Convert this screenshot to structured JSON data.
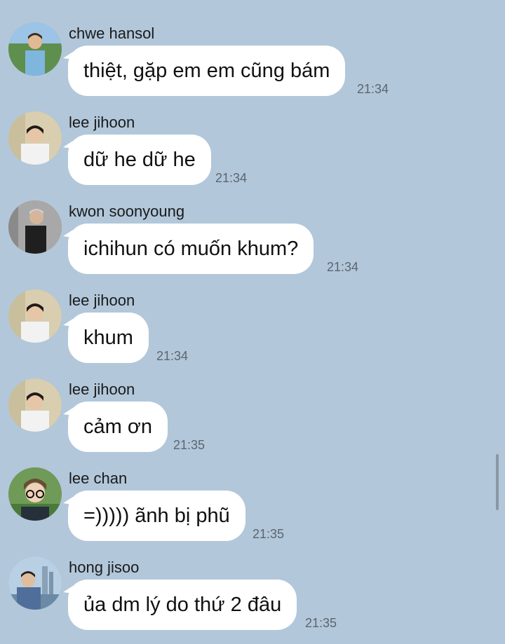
{
  "messages": [
    {
      "sender": "chwe hansol",
      "text": "thiệt, gặp em em cũng bám",
      "time": "21:34",
      "avatar": "chwe-hansol-avatar"
    },
    {
      "sender": "lee jihoon",
      "text": "dữ he dữ he",
      "time": "21:34",
      "avatar": "lee-jihoon-avatar"
    },
    {
      "sender": "kwon soonyoung",
      "text": "ichihun có muốn khum?",
      "time": "21:34",
      "avatar": "kwon-soonyoung-avatar"
    },
    {
      "sender": "lee jihoon",
      "text": "khum",
      "time": "21:34",
      "avatar": "lee-jihoon-avatar"
    },
    {
      "sender": "lee jihoon",
      "text": "cảm ơn",
      "time": "21:35",
      "avatar": "lee-jihoon-avatar"
    },
    {
      "sender": "lee chan",
      "text": "=))))) ãnh bị phũ",
      "time": "21:35",
      "avatar": "lee-chan-avatar"
    },
    {
      "sender": "hong jisoo",
      "text": "ủa dm lý do thứ 2 đâu",
      "time": "21:35",
      "avatar": "hong-jisoo-avatar"
    }
  ],
  "colors": {
    "background": "#b2c7da",
    "bubble": "#ffffff",
    "timestamp": "#5b6670"
  }
}
